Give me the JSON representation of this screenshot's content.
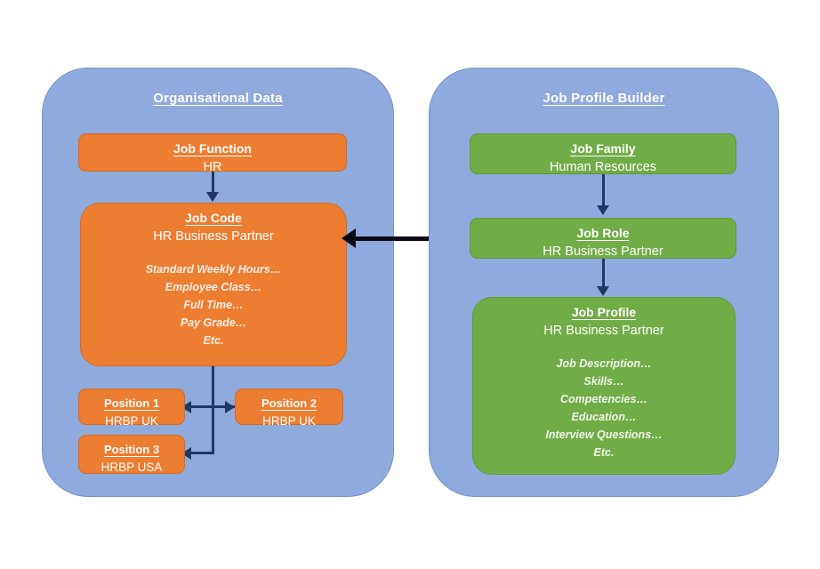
{
  "diagram": {
    "title_left": "Organisational Data",
    "title_right": "Job Profile Builder"
  },
  "colors": {
    "panel": "#8FAADC",
    "orange": "#ED7D31",
    "green": "#70AD47",
    "connector": "#1F3864",
    "link_arrow": "#0A0A14",
    "text": "#FFFFFF",
    "background": "#FFFFFF"
  },
  "left_panel": {
    "title": "Organisational Data",
    "nodes": {
      "job_function": {
        "title": "Job Function",
        "subtitle": "HR"
      },
      "job_code": {
        "title": "Job Code",
        "subtitle": "HR Business Partner",
        "details": [
          "Standard Weekly Hours…",
          "Employee Class…",
          "Full Time…",
          "Pay Grade…",
          "Etc."
        ]
      },
      "position_1": {
        "title": "Position 1",
        "subtitle": "HRBP UK"
      },
      "position_2": {
        "title": "Position 2",
        "subtitle": "HRBP  UK"
      },
      "position_3": {
        "title": "Position 3",
        "subtitle": "HRBP USA"
      }
    }
  },
  "right_panel": {
    "title": "Job Profile Builder",
    "nodes": {
      "job_family": {
        "title": "Job Family",
        "subtitle": "Human Resources"
      },
      "job_role": {
        "title": "Job Role",
        "subtitle": "HR Business Partner"
      },
      "job_profile": {
        "title": "Job Profile",
        "subtitle": "HR Business Partner",
        "details": [
          "Job Description…",
          "Skills…",
          "Competencies…",
          "Education…",
          "Interview Questions…",
          "Etc."
        ]
      }
    }
  }
}
